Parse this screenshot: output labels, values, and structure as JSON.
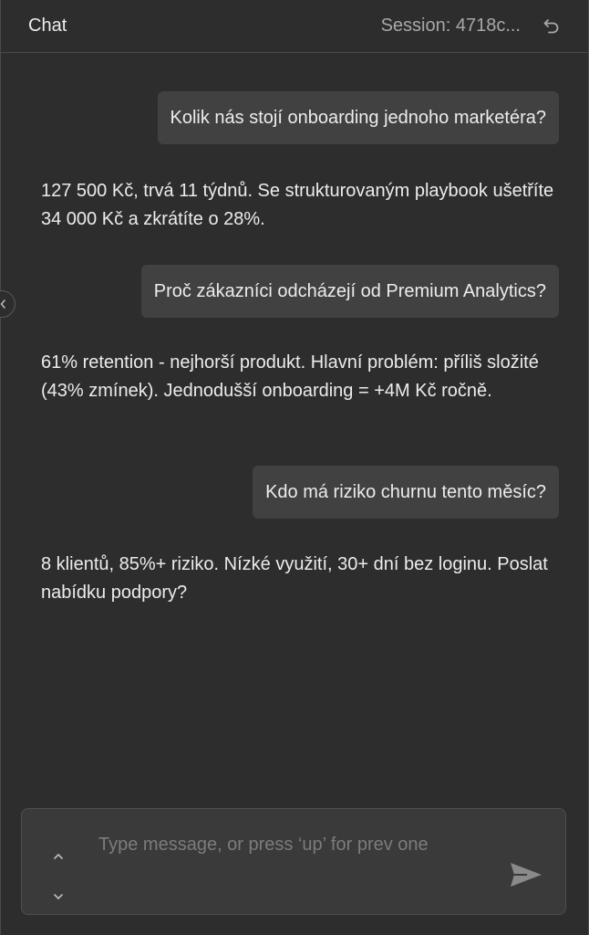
{
  "header": {
    "title": "Chat",
    "session_label": "Session: 4718c..."
  },
  "icons": {
    "undo": "undo-icon",
    "collapse": "chevron-left-icon",
    "history_up": "chevron-up-icon",
    "history_down": "chevron-down-icon",
    "send": "send-icon"
  },
  "messages": [
    {
      "role": "user",
      "text": "Kolik nás stojí onboarding jednoho marketéra?"
    },
    {
      "role": "assistant",
      "text": "127 500 Kč, trvá 11 týdnů. Se strukturovaným playbook ušetříte 34 000 Kč a zkrátíte o 28%."
    },
    {
      "role": "user",
      "text": "Proč zákazníci odcházejí od Premium Analytics?"
    },
    {
      "role": "assistant",
      "text": "61% retention - nejhorší produkt. Hlavní problém: příliš složité (43% zmínek). Jednodušší onboarding = +4M Kč ročně."
    },
    {
      "role": "user",
      "text": "Kdo má riziko churnu tento měsíc?"
    },
    {
      "role": "assistant",
      "text": "8 klientů, 85%+ riziko. Nízké využití, 30+ dní bez loginu. Poslat nabídku podpory?"
    }
  ],
  "composer": {
    "value": "",
    "placeholder": "Type message, or press ‘up’ for prev one"
  },
  "colors": {
    "background": "#2d2d2d",
    "user_bubble": "#414141",
    "input_background": "#3a3a3a",
    "text": "#ececec",
    "muted": "#a8a8a8",
    "placeholder": "#7c7c7c"
  }
}
